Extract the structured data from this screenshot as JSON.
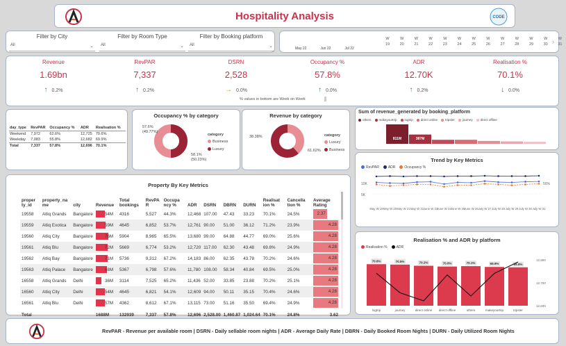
{
  "header": {
    "title": "Hospitality Analysis",
    "badge_text": "CODE"
  },
  "filters": [
    {
      "label": "Filter by City",
      "value": "All"
    },
    {
      "label": "Filter by Room Type",
      "value": "All"
    },
    {
      "label": "Filter by Booking platform",
      "value": "All"
    }
  ],
  "dates": {
    "months": [
      "May 22",
      "Jun 22",
      "Jul 22"
    ],
    "weeks": [
      {
        "w": "W",
        "n": "19"
      },
      {
        "w": "W",
        "n": "20"
      },
      {
        "w": "W",
        "n": "21"
      },
      {
        "w": "W",
        "n": "22"
      },
      {
        "w": "W",
        "n": "23"
      },
      {
        "w": "W",
        "n": "24"
      },
      {
        "w": "W",
        "n": "25"
      },
      {
        "w": "W",
        "n": "26"
      },
      {
        "w": "W",
        "n": "27"
      },
      {
        "w": "W",
        "n": "28"
      },
      {
        "w": "W",
        "n": "29"
      },
      {
        "w": "W",
        "n": "30"
      },
      {
        "w": "W",
        "n": "31"
      }
    ]
  },
  "kpis": [
    {
      "name": "Revenue",
      "value": "1.69bn",
      "change": "0.2%",
      "dir": "up"
    },
    {
      "name": "RevPAR",
      "value": "7,337",
      "change": "0.2%",
      "dir": "up"
    },
    {
      "name": "DSRN",
      "value": "2,528",
      "change": "0.0%",
      "dir": "side"
    },
    {
      "name": "Occupancy %",
      "value": "57.8%",
      "change": "0.0%",
      "dir": "up"
    },
    {
      "name": "ADR",
      "value": "12.70K",
      "change": "0.2%",
      "dir": "up"
    },
    {
      "name": "Realisation %",
      "value": "70.1%",
      "change": "0.0%",
      "dir": "down"
    }
  ],
  "kpi_note": "% values in bottom are Week on Week",
  "day_table": {
    "headers": [
      "day_type",
      "RevPAR",
      "Occupancy %",
      "ADR",
      "Realisation %"
    ],
    "rows": [
      [
        "Weekend",
        "7,972",
        "62.6%",
        "12,725",
        "70.6%"
      ],
      [
        "Weekday",
        "7,083",
        "55.8%",
        "12,682",
        "69.9%"
      ],
      [
        "Total",
        "7,337",
        "57.8%",
        "12,696",
        "70.1%"
      ]
    ]
  },
  "occupancy_donut": {
    "title": "Occupancy % by category",
    "legend_title": "category",
    "labels": [
      "57.6%",
      "(49.77%)",
      "58.1%",
      "(50.23%)"
    ],
    "categories": [
      "Business",
      "Luxury"
    ]
  },
  "revenue_donut": {
    "title": "Revenue by category",
    "legend_title": "category",
    "labels": [
      "38.38%",
      "61.62%"
    ],
    "categories": [
      "Luxury",
      "Business"
    ]
  },
  "property_table": {
    "title": "Property By Key Metrics",
    "headers": [
      "proper ty_id",
      "property_na me",
      "city",
      "Revenue",
      "Total bookings",
      "RevPA R",
      "Occupa ncy %",
      "ADR",
      "DSRN",
      "DBRN",
      "DURN",
      "Realisat ion %",
      "Cancella tion %",
      "Average Rating"
    ],
    "rows": [
      {
        "id": "19558",
        "name": "Atliq Grands",
        "city": "Bangalore",
        "revenue": "54M",
        "rev_m": 54,
        "bookings": "4316",
        "revpar": "5,527",
        "occ": "44.3%",
        "adr": "12,468",
        "dsrn": "107.00",
        "dbrn": "47.43",
        "durn": "33.23",
        "realis": "70.1%",
        "cancel": "24.5%",
        "rating": "2.37",
        "rating_v": 2.37
      },
      {
        "id": "19559",
        "name": "Atliq Exotica",
        "city": "Bangalore",
        "revenue": "59M",
        "rev_m": 59,
        "bookings": "4645",
        "revpar": "6,852",
        "occ": "53.7%",
        "adr": "12,761",
        "dsrn": "90.00",
        "dbrn": "51.00",
        "durn": "36.12",
        "realis": "71.2%",
        "cancel": "23.9%",
        "rating": "4.28",
        "rating_v": 4.28
      },
      {
        "id": "19560",
        "name": "Atliq City",
        "city": "Bangalore",
        "revenue": "76M",
        "rev_m": 76,
        "bookings": "5904",
        "revpar": "8,965",
        "occ": "65.5%",
        "adr": "13,680",
        "dsrn": "99.00",
        "dbrn": "64.88",
        "durn": "44.77",
        "realis": "69.0%",
        "cancel": "25.6%",
        "rating": "4.28",
        "rating_v": 4.28
      },
      {
        "id": "19561",
        "name": "Atliq Blu",
        "city": "Bangalore",
        "revenue": "72M",
        "rev_m": 72,
        "bookings": "5669",
        "revpar": "6,774",
        "occ": "53.2%",
        "adr": "12,720",
        "dsrn": "117.00",
        "dbrn": "62.30",
        "durn": "43.48",
        "realis": "69.8%",
        "cancel": "24.9%",
        "rating": "4.28",
        "rating_v": 4.28
      },
      {
        "id": "19562",
        "name": "Atliq Bay",
        "city": "Bangalore",
        "revenue": "71M",
        "rev_m": 71,
        "bookings": "5736",
        "revpar": "9,312",
        "occ": "67.2%",
        "adr": "14,183",
        "dsrn": "86.00",
        "dbrn": "62.35",
        "durn": "43.78",
        "realis": "70.2%",
        "cancel": "24.6%",
        "rating": "4.28",
        "rating_v": 4.28
      },
      {
        "id": "19563",
        "name": "Atliq Palace",
        "city": "Bangalore",
        "revenue": "68M",
        "rev_m": 68,
        "bookings": "5367",
        "revpar": "6,798",
        "occ": "57.6%",
        "adr": "11,780",
        "dsrn": "108.00",
        "dbrn": "58.34",
        "durn": "40.84",
        "realis": "69.5%",
        "cancel": "25.0%",
        "rating": "4.28",
        "rating_v": 4.28
      },
      {
        "id": "16558",
        "name": "Atliq Grands",
        "city": "Delhi",
        "revenue": "36M",
        "rev_m": 36,
        "bookings": "3114",
        "revpar": "7,525",
        "occ": "65.2%",
        "adr": "11,436",
        "dsrn": "52.00",
        "dbrn": "33.85",
        "durn": "23.88",
        "realis": "70.2%",
        "cancel": "25.1%",
        "rating": "4.28",
        "rating_v": 4.28
      },
      {
        "id": "16560",
        "name": "Atliq City",
        "city": "Delhi",
        "revenue": "54M",
        "rev_m": 54,
        "bookings": "4645",
        "revpar": "6,821",
        "occ": "54.1%",
        "adr": "12,609",
        "dsrn": "94.00",
        "dbrn": "50.11",
        "durn": "35.15",
        "realis": "70.4%",
        "cancel": "24.6%",
        "rating": "4.28",
        "rating_v": 4.28
      },
      {
        "id": "16561",
        "name": "Atliq Blu",
        "city": "Delhi",
        "revenue": "57M",
        "rev_m": 57,
        "bookings": "4362",
        "revpar": "8,612",
        "occ": "67.1%",
        "adr": "13,115",
        "dsrn": "73.00",
        "dbrn": "51.16",
        "durn": "35.50",
        "realis": "69.4%",
        "cancel": "24.9%",
        "rating": "4.28",
        "rating_v": 4.28
      }
    ],
    "total": {
      "label": "Total",
      "revenue": "1688M",
      "bookings": "132939",
      "revpar": "7,337",
      "occ": "57.8%",
      "adr": "12,696",
      "dsrn": "2,528.00",
      "dbrn": "1,460.87",
      "durn": "1,024.64",
      "realis": "70.1%",
      "cancel": "24.8%",
      "rating": "3.62"
    }
  },
  "chart_data": [
    {
      "type": "bar",
      "title": "Sum of revenue_generated by booking_platform",
      "categories": [
        "others",
        "makeyourtrip",
        "logtrip",
        "direct online",
        "tripster",
        "journey",
        "direct offline"
      ],
      "values": [
        811,
        387,
        168,
        169,
        120,
        101,
        84
      ],
      "data_labels": [
        "811M",
        "387M",
        "",
        "",
        "",
        "",
        ""
      ],
      "colors": [
        "#7b1f2c",
        "#a2303f",
        "#c24a58",
        "#d96a74",
        "#e48c93",
        "#eba7ad",
        "#f1c0c4"
      ]
    },
    {
      "type": "line",
      "title": "Trend by Key Metrics",
      "x": [
        "May W 19",
        "May W 20",
        "May W 21",
        "May W 22",
        "June W 23",
        "June W 24",
        "June W 25",
        "June W 26",
        "July W 27",
        "July W 28",
        "July W 29",
        "July W 30",
        "July W 31"
      ],
      "series": [
        {
          "name": "RevPAR",
          "values": [
            7300,
            7200,
            7150,
            7350,
            7400,
            7050,
            7300,
            7250,
            7500,
            7350,
            7300,
            7400,
            7450
          ],
          "color": "#4b6bd6"
        },
        {
          "name": "ADR",
          "values": [
            12650,
            12700,
            12650,
            12700,
            12700,
            12650,
            12700,
            12700,
            12750,
            12700,
            12700,
            12700,
            12750
          ],
          "color": "#1f2d6b"
        },
        {
          "name": "Occupancy %",
          "values": [
            58,
            56,
            57,
            58,
            58,
            55,
            57,
            57,
            59,
            58,
            57,
            58,
            59
          ],
          "color": "#e8762c"
        }
      ],
      "yticks_left": [
        "10K",
        "5K"
      ],
      "yticks_right": [
        "50%"
      ]
    },
    {
      "type": "bar",
      "title": "Realisation % and ADR by platform",
      "categories": [
        "logtrip",
        "journey",
        "direct online",
        "direct offline",
        "others",
        "makeyourtrip",
        "tripster"
      ],
      "series": [
        {
          "name": "Realisation %",
          "values": [
            70.6,
            70.5,
            70.2,
            70.0,
            70.1,
            69.9,
            69.8
          ],
          "labels": [
            "70.6%",
            "70.5%",
            "70.2%",
            "70.0%",
            "70.1%",
            "69.9%",
            "69.8%"
          ],
          "color": "#dc3a4d"
        },
        {
          "name": "ADR",
          "values": [
            12760,
            12640,
            12590,
            12750,
            12620,
            12760,
            12830
          ],
          "color": "#111111"
        }
      ],
      "y_right_ticks": [
        "12,800",
        "12,700",
        "12,600"
      ]
    }
  ],
  "footer": {
    "text": "RevPAR - Revenue per available room | DSRN - Daily sellable room nights | ADR - Average Daily Rate | DBRN - Daily Booked Room Nights | DURN - Daily Utilized Room Nights"
  }
}
